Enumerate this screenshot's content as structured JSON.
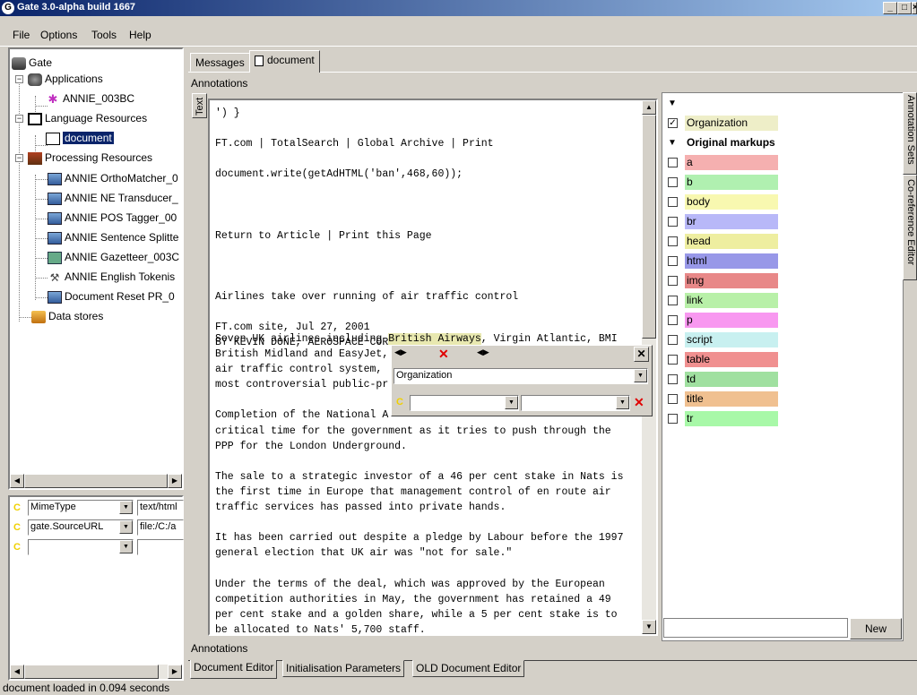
{
  "window": {
    "title": "Gate 3.0-alpha build 1667",
    "controls": [
      "_",
      "□",
      "×"
    ]
  },
  "menu": [
    "File",
    "Options",
    "Tools",
    "Help"
  ],
  "tree": {
    "root": "Gate",
    "applications": "Applications",
    "annie_app": "ANNIE_003BC",
    "language_resources": "Language Resources",
    "document": "document",
    "processing_resources": "Processing Resources",
    "pr_items": [
      "ANNIE OrthoMatcher_0",
      "ANNIE NE Transducer_",
      "ANNIE POS Tagger_00",
      "ANNIE Sentence Splitte",
      "ANNIE Gazetteer_003C",
      "ANNIE English Tokenis",
      "Document Reset PR_0"
    ],
    "data_stores": "Data stores"
  },
  "features": [
    {
      "name": "MimeType",
      "value": "text/html"
    },
    {
      "name": "gate.SourceURL",
      "value": "file:/C:/a"
    },
    {
      "name": "",
      "value": ""
    }
  ],
  "tabs": {
    "messages": "Messages",
    "document": "document"
  },
  "annotations_label": "Annotations",
  "annotations_bottom_label": "Annotations",
  "text_vtab": "Text",
  "document_text": "') }\n\nFT.com | TotalSearch | Global Archive | Print\n\ndocument.write(getAdHTML('ban',468,60));\n\n\n\nReturn to Article | Print this Page\n\n\n\nAirlines take over running of air traffic control\n\nFT.com site, Jul 27, 2001\nBY KEVIN DONE, AEROSPACE CORRESPONDENT\n\n",
  "doc_para1": [
    "Seven UK airlines including ",
    "British Airways",
    ", Virgin Atlantic, BMI",
    "British Midland and EasyJet,",
    "air traffic control system,",
    "most controversial public-pr"
  ],
  "doc_text_rest": "\nCompletion of the National A\ncritical time for the government as it tries to push through the\nPPP for the London Underground.\n\nThe sale to a strategic investor of a 46 per cent stake in Nats is\nthe first time in Europe that management control of en route air\ntraffic services has passed into private hands.\n\nIt has been carried out despite a pledge by Labour before the 1997\ngeneral election that UK air was \"not for sale.\"\n\nUnder the terms of the deal, which was approved by the European\ncompetition authorities in May, the government has retained a 49\nper cent stake and a golden share, while a 5 per cent stake is to\nbe allocated to Nats' 5,700 staff.",
  "popup": {
    "type": "Organization"
  },
  "annotation_sets": {
    "default_items": [
      {
        "label": "Organization",
        "checked": true,
        "color": "#eeeec8"
      }
    ],
    "original_markups_label": "Original markups",
    "markup_items": [
      {
        "label": "a",
        "color": "#f5b0b0"
      },
      {
        "label": "b",
        "color": "#b0f0b0"
      },
      {
        "label": "body",
        "color": "#f8f8b0"
      },
      {
        "label": "br",
        "color": "#b8b8f8"
      },
      {
        "label": "head",
        "color": "#eeeea0"
      },
      {
        "label": "html",
        "color": "#9898e8"
      },
      {
        "label": "img",
        "color": "#e88888"
      },
      {
        "label": "link",
        "color": "#b8f0a8"
      },
      {
        "label": "p",
        "color": "#f898f0"
      },
      {
        "label": "script",
        "color": "#c8f0f0"
      },
      {
        "label": "table",
        "color": "#f09090"
      },
      {
        "label": "td",
        "color": "#a0e0a0"
      },
      {
        "label": "title",
        "color": "#f0c090"
      },
      {
        "label": "tr",
        "color": "#a8f8a8"
      }
    ],
    "new_button": "New",
    "new_input": ""
  },
  "side_tabs": {
    "annotation_sets": "Annotation Sets",
    "coreference": "Co-reference Editor"
  },
  "bottom_tabs": [
    "Document Editor",
    "Initialisation Parameters",
    "OLD Document Editor"
  ],
  "status": "document loaded in 0.094 seconds"
}
